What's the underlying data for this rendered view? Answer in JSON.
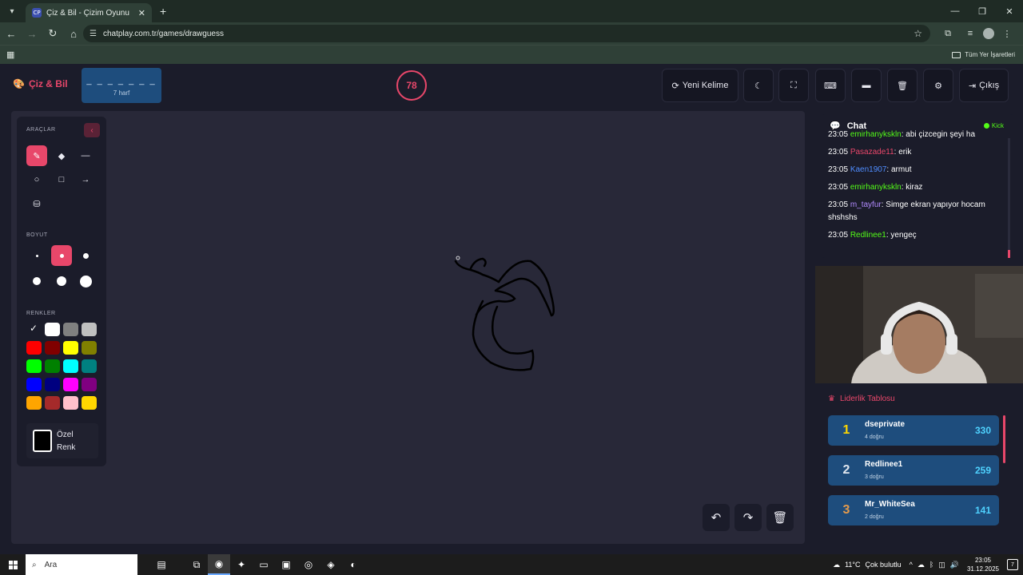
{
  "browser": {
    "tab_title": "Çiz & Bil - Çizim Oyunu",
    "favicon": "CP",
    "url": "chatplay.com.tr/games/drawguess",
    "bookmarks_label": "Tüm Yer İşaretleri"
  },
  "header": {
    "brand": "Çiz & Bil",
    "word_dashes": "_ _ _ _ _ _ _",
    "word_hint": "7 harf",
    "timer": "78",
    "new_word": "Yeni Kelime",
    "exit": "Çıkış"
  },
  "tools": {
    "tools_label": "ARAÇLAR",
    "size_label": "BOYUT",
    "colors_label": "RENKLER",
    "custom_color_line1": "Özel",
    "custom_color_line2": "Renk",
    "selected_tool": "brush",
    "colors": [
      "#000000",
      "#ffffff",
      "#808080",
      "#c0c0c0",
      "#ff0000",
      "#800000",
      "#ffff00",
      "#808000",
      "#00ff00",
      "#008000",
      "#00ffff",
      "#008080",
      "#0000ff",
      "#000080",
      "#ff00ff",
      "#800080",
      "#ffa500",
      "#a52a2a",
      "#ffc0cb",
      "#ffd700"
    ]
  },
  "chat": {
    "title": "Chat",
    "platform": "Kick",
    "messages": [
      {
        "time": "23:05",
        "user": "emirhanykskln",
        "text": ": abi çizcegin şeyi ha",
        "color": "#53fc18"
      },
      {
        "time": "23:05",
        "user": "Pasazade11",
        "text": ": erik",
        "color": "#e8476a"
      },
      {
        "time": "23:05",
        "user": "Kaen1907",
        "text": ": armut",
        "color": "#4f8dff"
      },
      {
        "time": "23:05",
        "user": "emirhanykskln",
        "text": ": kiraz",
        "color": "#53fc18"
      },
      {
        "time": "23:05",
        "user": "m_tayfur",
        "text": ": Simge ekran yapıyor hocam shshshs",
        "color": "#b28bff"
      },
      {
        "time": "23:05",
        "user": "Redlinee1",
        "text": ": yengeç",
        "color": "#53fc18"
      }
    ]
  },
  "leaderboard": {
    "title": "Liderlik Tablosu",
    "rows": [
      {
        "rank": "1",
        "name": "dseprivate",
        "sub": "4 doğru",
        "score": "330",
        "rank_color": "#ffd700"
      },
      {
        "rank": "2",
        "name": "Redlinee1",
        "sub": "3 doğru",
        "score": "259",
        "rank_color": "#e0e6ee"
      },
      {
        "rank": "3",
        "name": "Mr_WhiteSea",
        "sub": "2 doğru",
        "score": "141",
        "rank_color": "#e39a4c"
      }
    ]
  },
  "taskbar": {
    "search": "Ara",
    "temp": "11°C",
    "weather": "Çok bulutlu",
    "time": "23:05",
    "date": "31.12.2025",
    "notif_count": "7"
  },
  "accent": "#e8476a"
}
